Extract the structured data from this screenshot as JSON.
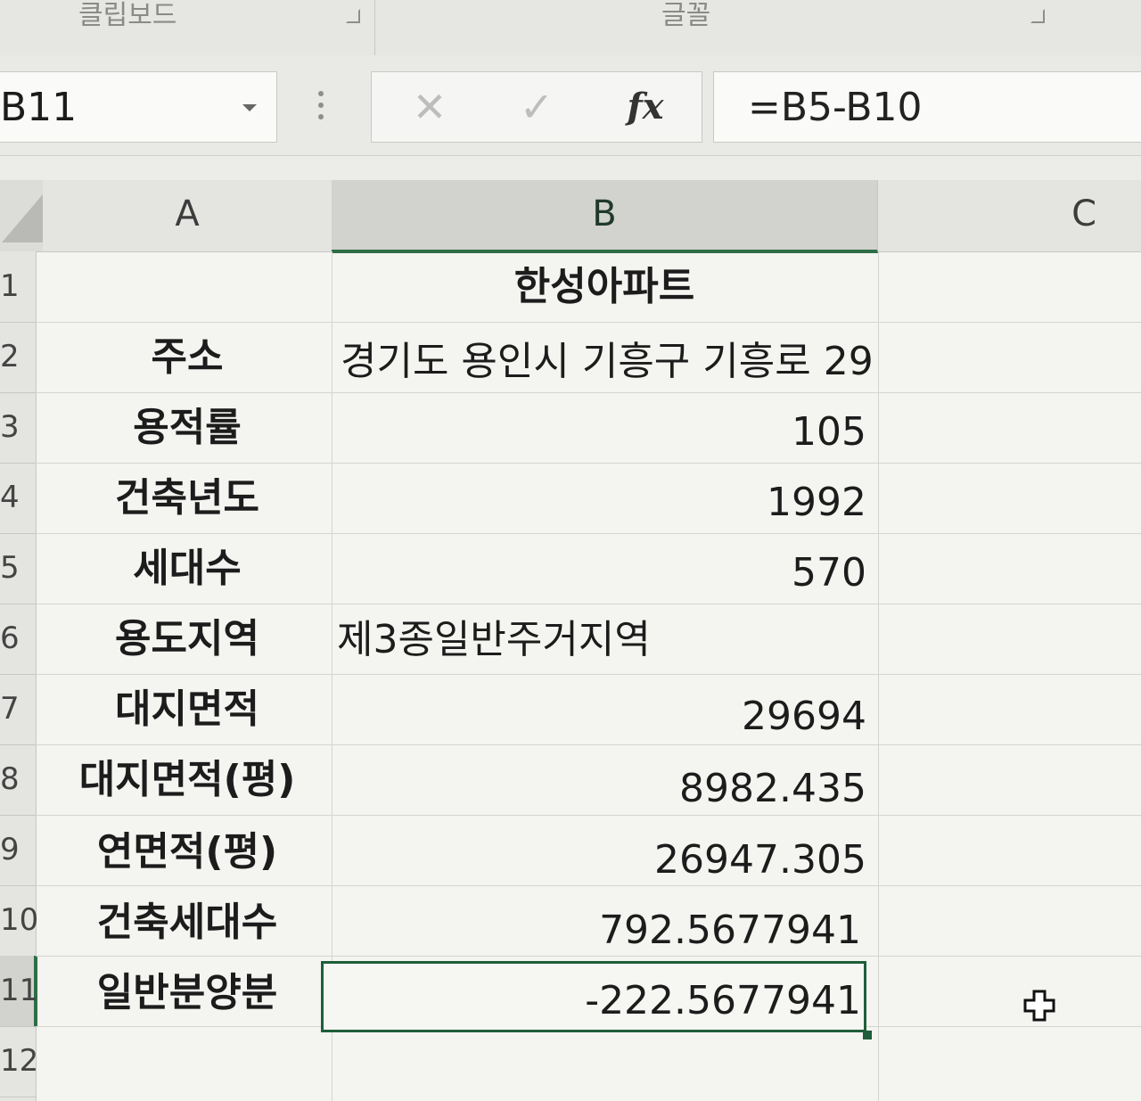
{
  "ribbon": {
    "groups": [
      {
        "label": "클립보드"
      },
      {
        "label": "글꼴"
      }
    ]
  },
  "formula_bar": {
    "name_box": "B11",
    "cancel_icon": "close-icon",
    "enter_icon": "check-icon",
    "fx_label": "fx",
    "formula": "=B5-B10"
  },
  "columns": [
    "A",
    "B",
    "C"
  ],
  "selected_column": "B",
  "rows": [
    {
      "num": "1",
      "label": "",
      "value": "한성아파트"
    },
    {
      "num": "2",
      "label": "주소",
      "value": "경기도 용인시 기흥구 기흥로 29"
    },
    {
      "num": "3",
      "label": "용적률",
      "value": "105"
    },
    {
      "num": "4",
      "label": "건축년도",
      "value": "1992"
    },
    {
      "num": "5",
      "label": "세대수",
      "value": "570"
    },
    {
      "num": "6",
      "label": "용도지역",
      "value": "제3종일반주거지역"
    },
    {
      "num": "7",
      "label": "대지면적",
      "value": "29694"
    },
    {
      "num": "8",
      "label": "대지면적(평)",
      "value": "8982.435"
    },
    {
      "num": "9",
      "label": "연면적(평)",
      "value": "26947.305"
    },
    {
      "num": "10",
      "label": "건축세대수",
      "value": "792.5677941"
    },
    {
      "num": "11",
      "label": "일반분양분",
      "value": "-222.5677941"
    },
    {
      "num": "12",
      "label": "",
      "value": ""
    }
  ],
  "selected_cell": "B11",
  "colors": {
    "accent": "#1f5e3a"
  }
}
